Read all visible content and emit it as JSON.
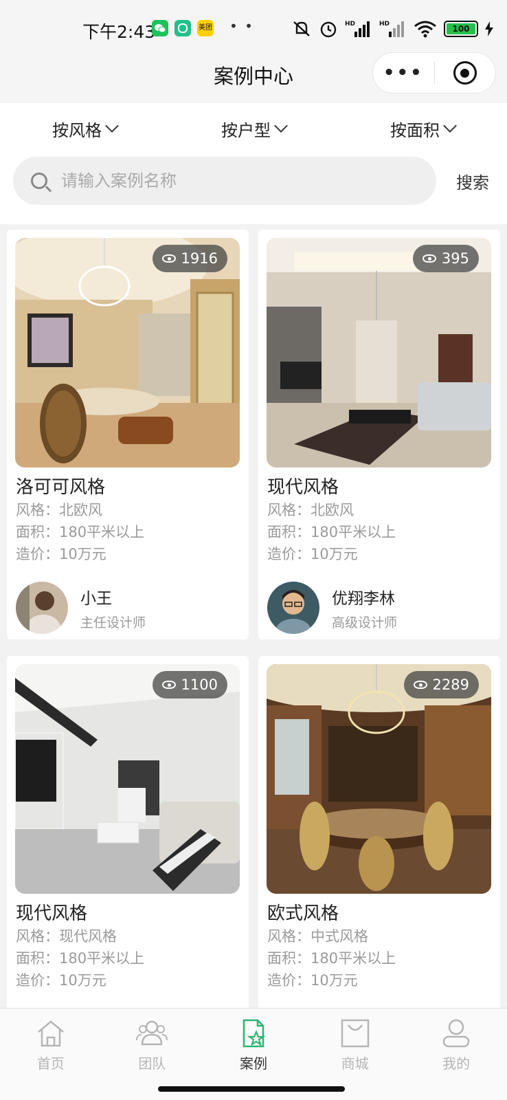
{
  "status_bar": {
    "time": "下午2:43",
    "app_icons": [
      "wechat-icon",
      "app-icon",
      "meituan-icon"
    ],
    "meituan_label": "美团",
    "more_dots": "• •",
    "battery": "100"
  },
  "navbar": {
    "title": "案例中心",
    "more_label": "•••"
  },
  "filters": [
    {
      "label": "按风格"
    },
    {
      "label": "按户型"
    },
    {
      "label": "按面积"
    }
  ],
  "search": {
    "placeholder": "请输入案例名称",
    "button": "搜索"
  },
  "cards": [
    {
      "title": "洛可可风格",
      "views": "1916",
      "style": "风格：北欧风",
      "area": "面积：180平米以上",
      "cost": "造价：10万元",
      "designer": "小王",
      "role": "主任设计师"
    },
    {
      "title": "现代风格",
      "views": "395",
      "style": "风格：北欧风",
      "area": "面积：180平米以上",
      "cost": "造价：10万元",
      "designer": "优翔李林",
      "role": "高级设计师"
    },
    {
      "title": "现代风格",
      "views": "1100",
      "style": "风格：现代风格",
      "area": "面积：180平米以上",
      "cost": "造价：10万元"
    },
    {
      "title": "欧式风格",
      "views": "2289",
      "style": "风格：中式风格",
      "area": "面积：180平米以上",
      "cost": "造价：10万元"
    }
  ],
  "tabbar": [
    {
      "label": "首页",
      "icon": "home-icon"
    },
    {
      "label": "团队",
      "icon": "team-icon"
    },
    {
      "label": "案例",
      "icon": "case-icon",
      "active": true
    },
    {
      "label": "商城",
      "icon": "shop-icon"
    },
    {
      "label": "我的",
      "icon": "profile-icon"
    }
  ],
  "colors": {
    "accent": "#2bb673",
    "active_text": "#333333",
    "inactive_text": "#b5b5b5"
  }
}
